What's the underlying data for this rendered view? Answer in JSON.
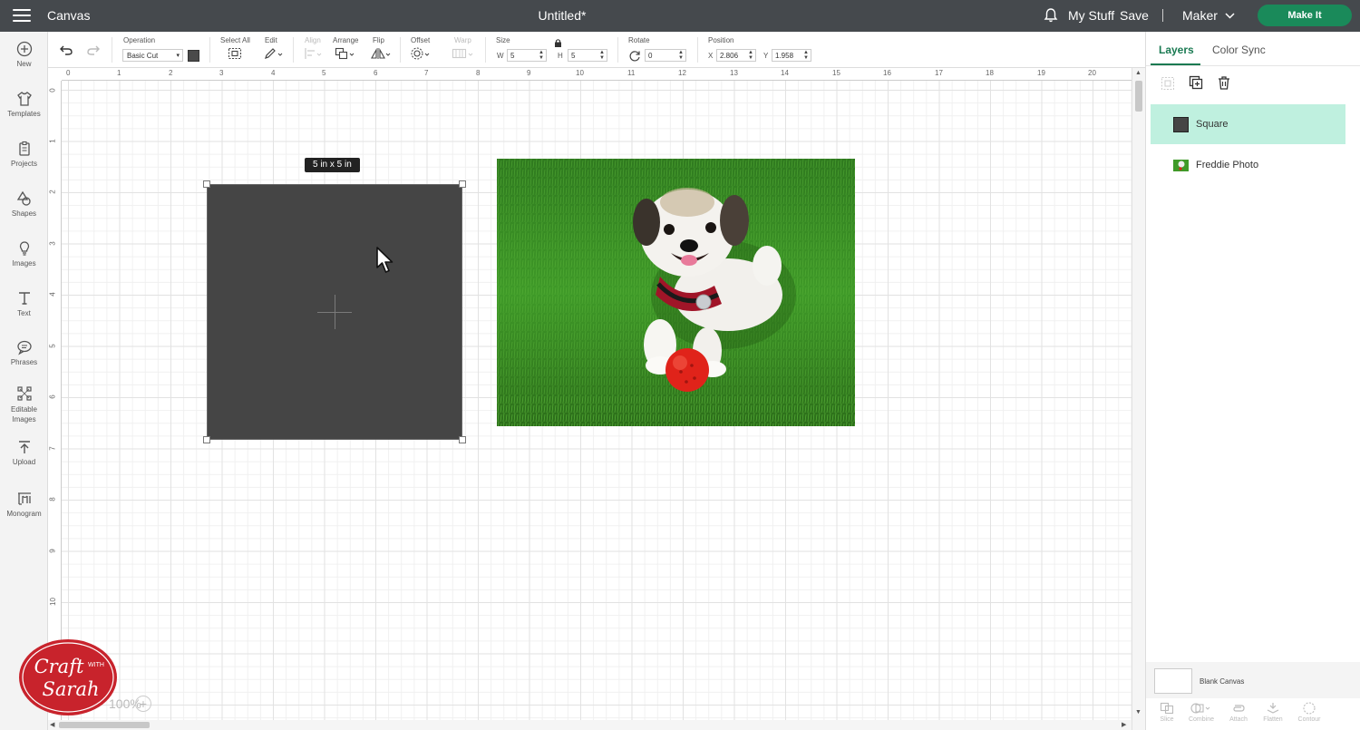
{
  "header": {
    "app_title": "Canvas",
    "doc_title": "Untitled*",
    "my_stuff": "My Stuff",
    "save": "Save",
    "machine": "Maker",
    "make_it": "Make It"
  },
  "sidebar": {
    "items": [
      {
        "label": "New",
        "icon": "plus-circle-icon"
      },
      {
        "label": "Templates",
        "icon": "shirt-icon"
      },
      {
        "label": "Projects",
        "icon": "clipboard-icon"
      },
      {
        "label": "Shapes",
        "icon": "shapes-icon"
      },
      {
        "label": "Images",
        "icon": "lightbulb-icon"
      },
      {
        "label": "Text",
        "icon": "text-icon"
      },
      {
        "label": "Phrases",
        "icon": "speech-bubble-icon"
      },
      {
        "label": "Editable Images",
        "icon": "editable-image-icon"
      },
      {
        "label": "Upload",
        "icon": "upload-icon"
      },
      {
        "label": "Monogram",
        "icon": "monogram-icon"
      }
    ]
  },
  "toolbar": {
    "operation_label": "Operation",
    "operation_value": "Basic Cut",
    "operation_color": "#4a4a4a",
    "select_all": "Select All",
    "edit": "Edit",
    "align": "Align",
    "arrange": "Arrange",
    "flip": "Flip",
    "offset": "Offset",
    "warp": "Warp",
    "size_label": "Size",
    "w_label": "W",
    "w_value": "5",
    "h_label": "H",
    "h_value": "5",
    "rotate_label": "Rotate",
    "rotate_value": "0",
    "position_label": "Position",
    "x_label": "X",
    "x_value": "2.806",
    "y_label": "Y",
    "y_value": "1.958"
  },
  "canvas": {
    "ruler_top": [
      "0",
      "1",
      "2",
      "3",
      "4",
      "5",
      "6",
      "7",
      "8",
      "9",
      "10",
      "11",
      "12",
      "13",
      "14",
      "15",
      "16",
      "17",
      "18",
      "19",
      "20"
    ],
    "ruler_left": [
      "0",
      "1",
      "2",
      "3",
      "4",
      "5",
      "6",
      "7",
      "8",
      "9",
      "10"
    ],
    "size_tooltip": "5  in x 5  in",
    "zoom": "100%",
    "square_color": "#454545"
  },
  "layers_panel": {
    "tabs": [
      "Layers",
      "Color Sync"
    ],
    "layers": [
      {
        "name": "Square",
        "selected": true
      },
      {
        "name": "Freddie Photo",
        "selected": false
      }
    ],
    "blank_canvas": "Blank Canvas",
    "bottom_tools": [
      "Slice",
      "Combine",
      "Attach",
      "Flatten",
      "Contour"
    ]
  },
  "logo": {
    "line1": "Craft",
    "with": "WITH",
    "line2": "Sarah"
  },
  "colors": {
    "topbar": "#45494d",
    "accent": "#1a8a5a",
    "selected_layer": "#bff0df"
  }
}
